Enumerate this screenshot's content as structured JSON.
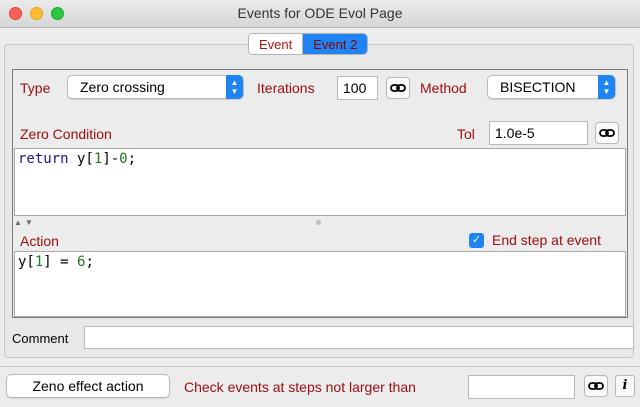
{
  "window": {
    "title": "Events for ODE Evol Page"
  },
  "tabs": [
    {
      "label": "Event",
      "active": false
    },
    {
      "label": "Event 2",
      "active": true
    }
  ],
  "type": {
    "label": "Type",
    "value": "Zero crossing"
  },
  "iterations": {
    "label": "Iterations",
    "value": "100"
  },
  "method": {
    "label": "Method",
    "value": "BISECTION"
  },
  "zero_condition": {
    "label": "Zero Condition",
    "code": {
      "keyword": "return",
      "pre": " y[",
      "index": "1",
      "mid": "]-",
      "value": "0",
      "end": ";"
    }
  },
  "tol": {
    "label": "Tol",
    "value": "1.0e-5"
  },
  "action": {
    "label": "Action",
    "code": {
      "pre": "y[",
      "index": "1",
      "mid": "] = ",
      "value": "6",
      "end": ";"
    }
  },
  "end_step": {
    "label": "End step at event",
    "checked": true
  },
  "comment": {
    "label": "Comment",
    "value": ""
  },
  "footer": {
    "zeno_button": "Zeno effect action",
    "check_events_label": "Check events at steps not larger than",
    "check_events_value": "",
    "info_icon_glyph": "i"
  },
  "icons": {
    "link": "link-icon",
    "info": "info-icon",
    "checkmark": "✓"
  },
  "colors": {
    "accent": "#1e84f4",
    "label_red": "#9c0d0d",
    "keyword": "#17179a",
    "number": "#1e7a1e"
  }
}
